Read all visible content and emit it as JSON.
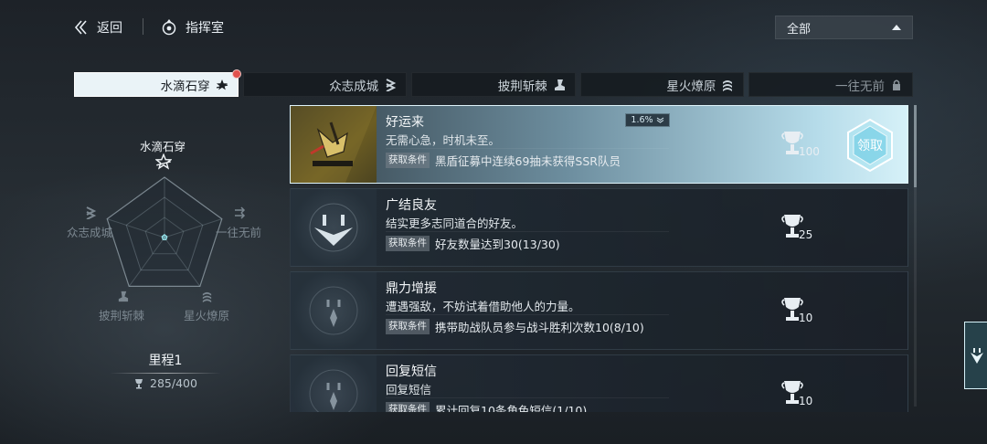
{
  "header": {
    "back_label": "返回",
    "section_label": "指挥室",
    "filter": {
      "selected": "全部"
    }
  },
  "tabs": [
    {
      "label": "水滴石穿",
      "icon": "star-badge-icon",
      "active": true,
      "has_notification": true
    },
    {
      "label": "众志成城",
      "icon": "chevron-stack-icon",
      "active": false
    },
    {
      "label": "披荆斩棘",
      "icon": "boot-icon",
      "active": false
    },
    {
      "label": "星火燎原",
      "icon": "wave-stack-icon",
      "active": false
    },
    {
      "label": "一往无前",
      "icon": "lock-icon",
      "active": false,
      "locked": true
    }
  ],
  "radar": {
    "axes": [
      {
        "label": "水滴石穿",
        "value": 0.05
      },
      {
        "label": "一往无前",
        "value": 0.02
      },
      {
        "label": "星火燎原",
        "value": 0.02
      },
      {
        "label": "披荆斩棘",
        "value": 0.02
      },
      {
        "label": "众志成城",
        "value": 0.02
      }
    ],
    "milestone_title": "里程1",
    "milestone_progress": "285/400"
  },
  "achievements": [
    {
      "title": "好运来",
      "rarity": "1.6%",
      "description": "无需心急，时机未至。",
      "condition_tag": "获取条件",
      "condition": "黑盾征募中连续69抽未获得SSR队员",
      "reward": "100",
      "claimable": true,
      "claim_label": "领取",
      "thumbnail": "gold-figure-icon"
    },
    {
      "title": "广结良友",
      "description": "结实更多志同道合的好友。",
      "condition_tag": "获取条件",
      "condition": "好友数量达到30(13/30)",
      "reward": "25",
      "claimable": false,
      "thumbnail": "emblem-icon"
    },
    {
      "title": "鼎力增援",
      "description": "遭遇强敌，不妨试着借助他人的力量。",
      "condition_tag": "获取条件",
      "condition": "携带助战队员参与战斗胜利次数10(8/10)",
      "reward": "10",
      "claimable": false,
      "thumbnail": "emblem-icon"
    },
    {
      "title": "回复短信",
      "description": "回复短信",
      "condition_tag": "获取条件",
      "condition": "累计回复10条角色短信(1/10)",
      "reward": "10",
      "claimable": false,
      "thumbnail": "emblem-icon"
    }
  ],
  "colors": {
    "accent": "#d6f1f8",
    "gold_thumb": "#6c5d23",
    "notification": "#e0524e"
  }
}
